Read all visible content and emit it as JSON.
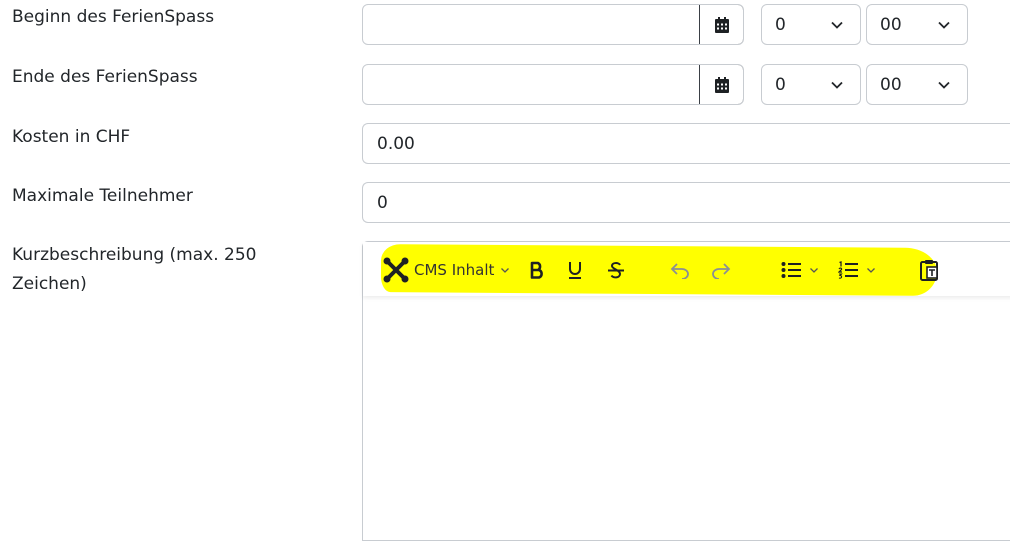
{
  "form": {
    "start_label": "Beginn des FerienSpass",
    "end_label": "Ende des FerienSpass",
    "cost_label": "Kosten in CHF",
    "max_label": "Maximale Teilnehmer",
    "desc_label": "Kurzbeschreibung (max. 250 Zeichen)",
    "start_date": "",
    "start_hour": "0",
    "start_minute": "00",
    "end_date": "",
    "end_hour": "0",
    "end_minute": "00",
    "cost_value": "0.00",
    "max_value": "0"
  },
  "editor": {
    "cms_label": "CMS Inhalt",
    "toolbar_icons": [
      "joomla-icon",
      "bold-icon",
      "underline-icon",
      "strikethrough-icon",
      "undo-icon",
      "redo-icon",
      "bullet-list-icon",
      "numbered-list-icon",
      "paste-as-text-icon"
    ],
    "highlight_color": "#ffff00"
  }
}
